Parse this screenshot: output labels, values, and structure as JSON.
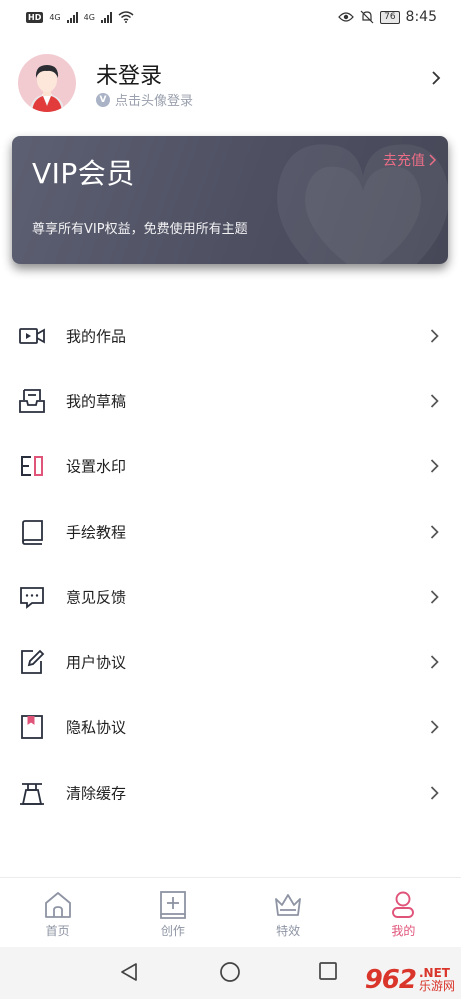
{
  "status_bar": {
    "hd_badge": "HD",
    "net1": "4G",
    "net2": "4G",
    "battery": "76",
    "time": "8:45"
  },
  "profile": {
    "name": "未登录",
    "hint": "点击头像登录",
    "badge": "V"
  },
  "vip": {
    "title": "VIP会员",
    "link": "去充值",
    "description": "尊享所有VIP权益，免费使用所有主题"
  },
  "menu": {
    "items": [
      {
        "label": "我的作品",
        "icon": "video-camera-icon"
      },
      {
        "label": "我的草稿",
        "icon": "drafts-tray-icon"
      },
      {
        "label": "设置水印",
        "icon": "watermark-icon"
      },
      {
        "label": "手绘教程",
        "icon": "book-icon"
      },
      {
        "label": "意见反馈",
        "icon": "feedback-chat-icon"
      },
      {
        "label": "用户协议",
        "icon": "document-edit-icon"
      },
      {
        "label": "隐私协议",
        "icon": "privacy-bookmark-icon"
      },
      {
        "label": "清除缓存",
        "icon": "clear-cache-icon"
      }
    ]
  },
  "tab_bar": {
    "tabs": [
      {
        "label": "首页",
        "icon": "home-icon",
        "active": false
      },
      {
        "label": "创作",
        "icon": "create-plus-icon",
        "active": false
      },
      {
        "label": "特效",
        "icon": "effects-basket-icon",
        "active": false
      },
      {
        "label": "我的",
        "icon": "profile-user-icon",
        "active": true
      }
    ]
  },
  "watermark": {
    "logo": "962",
    "net": ".NET",
    "site": "乐游网"
  },
  "colors": {
    "accent": "#e0547a",
    "vip_link": "#ec6e86",
    "vip_card": "#54566a",
    "tab_inactive": "#8e94a3"
  }
}
